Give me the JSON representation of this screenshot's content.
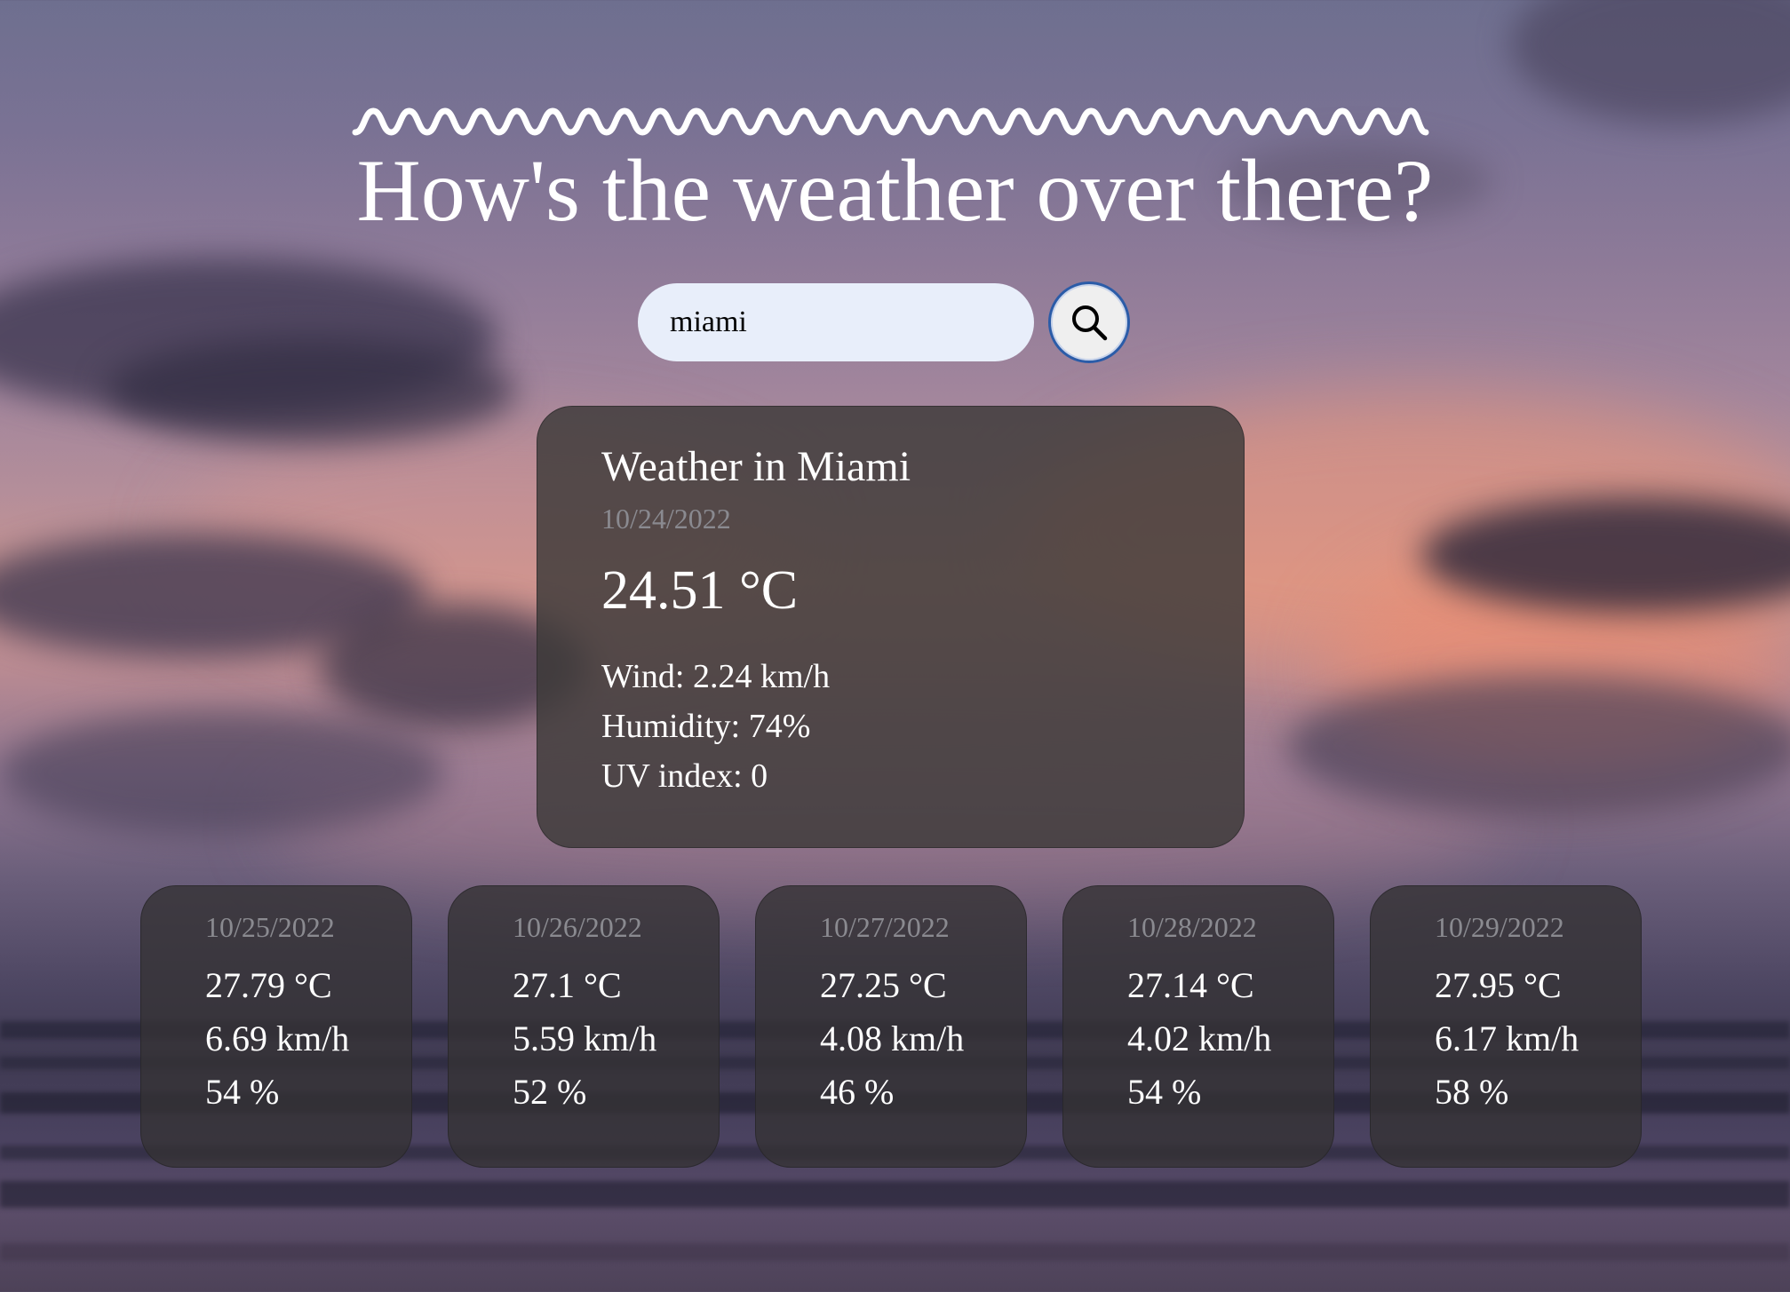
{
  "page": {
    "title": "How's the weather over there?"
  },
  "search": {
    "value": "miami",
    "button_icon": "search-icon"
  },
  "current": {
    "heading": "Weather in Miami",
    "date": "10/24/2022",
    "temperature": "24.51 °C",
    "wind": "Wind: 2.24 km/h",
    "humidity": "Humidity: 74%",
    "uv": "UV index: 0"
  },
  "forecast": [
    {
      "date": "10/25/2022",
      "temp": "27.79 °C",
      "wind": "6.69 km/h",
      "humidity": "54 %"
    },
    {
      "date": "10/26/2022",
      "temp": "27.1 °C",
      "wind": "5.59 km/h",
      "humidity": "52 %"
    },
    {
      "date": "10/27/2022",
      "temp": "27.25 °C",
      "wind": "4.08 km/h",
      "humidity": "46 %"
    },
    {
      "date": "10/28/2022",
      "temp": "27.14 °C",
      "wind": "4.02 km/h",
      "humidity": "54 %"
    },
    {
      "date": "10/29/2022",
      "temp": "27.95 °C",
      "wind": "6.17 km/h",
      "humidity": "58 %"
    }
  ],
  "colors": {
    "input_background": "#e8eefa",
    "button_border": "#2b5ca8",
    "card_background": "#3c3938",
    "date_text": "#8a8a90"
  }
}
